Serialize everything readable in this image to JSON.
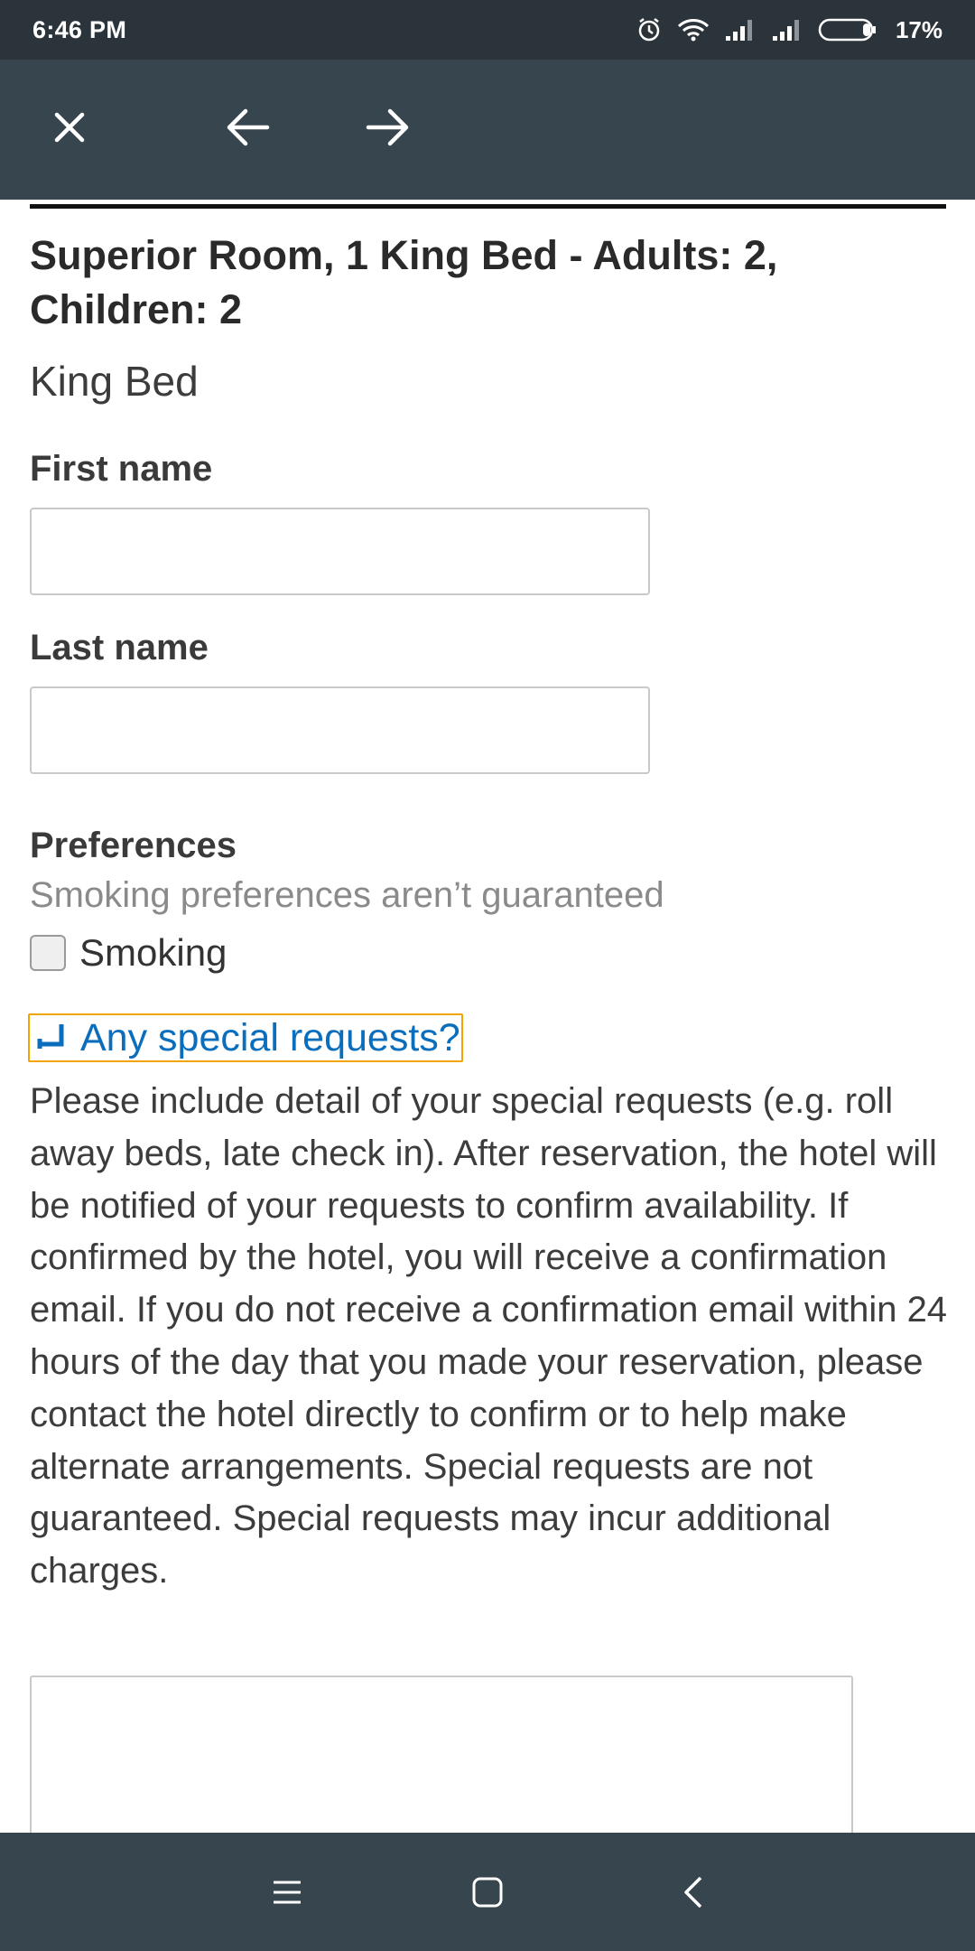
{
  "status_bar": {
    "time": "6:46 PM",
    "battery": "17%",
    "icons": [
      "alarm-icon",
      "wifi-icon",
      "signal-icon",
      "signal-icon",
      "battery-icon"
    ]
  },
  "toolbar": {
    "icons": [
      "close-icon",
      "arrow-left-icon",
      "arrow-right-icon"
    ]
  },
  "room": {
    "title": "Superior Room, 1 King Bed - Adults: 2, Children: 2",
    "bed_type": "King Bed"
  },
  "form": {
    "first_name_label": "First name",
    "first_name_value": "",
    "last_name_label": "Last name",
    "last_name_value": "",
    "preferences_label": "Preferences",
    "preferences_note": "Smoking preferences aren’t guaranteed",
    "smoking_label": "Smoking",
    "smoking_checked": false,
    "special_requests_link": "Any special requests?",
    "special_requests_desc": "Please include detail of your special requests (e.g. roll away beds, late check in). After reservation, the hotel will be notified of your requests to confirm availability. If confirmed by the hotel, you will receive a confirmation email. If you do not receive a confirmation email within 24 hours of the day that you made your reservation, please contact the hotel directly to confirm or to help make alternate arrangements. Special requests are not guaranteed. Special requests may incur additional charges.",
    "special_requests_value": ""
  },
  "nav_bar": {
    "icons": [
      "menu-icon",
      "home-square-icon",
      "back-chevron-icon"
    ]
  },
  "colors": {
    "status_bar_bg": "#2b343b",
    "toolbar_bg": "#36454e",
    "link_blue": "#0a6ebd",
    "focus_orange": "#f0a500"
  }
}
